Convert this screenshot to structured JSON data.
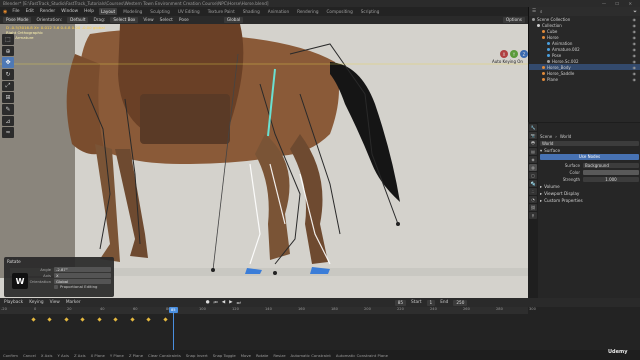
{
  "window": {
    "title": "Blender* [E:\\FastTrack_Studio\\FastTrack_Tutorials\\Courses\\Western Town Environment Creation Course\\NPC\\Horse\\Horse.blend]",
    "controls": "— ☐ ✕"
  },
  "menubar": {
    "menus": [
      "File",
      "Edit",
      "Render",
      "Window",
      "Help"
    ],
    "workspaces": [
      "Layout",
      "Modeling",
      "Sculpting",
      "UV Editing",
      "Texture Paint",
      "Shading",
      "Animation",
      "Rendering",
      "Compositing",
      "Scripting"
    ],
    "active_workspace": "Layout",
    "scene": "Scene",
    "view_layer": "View Layer"
  },
  "viewport_header": {
    "mode": "Pose Mode",
    "items": [
      "Orientation:",
      "Default",
      "Drag:",
      "Select Box",
      "View",
      "Select",
      "Pose"
    ],
    "transform": "Global",
    "options": "Options"
  },
  "viewport": {
    "info_line1": "D -0.5/3016.8  Xr: 0.012 3.6 0.4.8 0.00 -0.00 global",
    "info_line2": "Right Orthographic",
    "info_line3": "(54) Armature",
    "auto_keying": "Auto Keying On",
    "gizmo": [
      "X",
      "Y",
      "Z"
    ],
    "bone_color": "#3b7dd8",
    "horse_color": "#8a5a38",
    "tail_color": "#151515"
  },
  "tools": [
    "select-box",
    "cursor",
    "move",
    "rotate",
    "scale",
    "transform",
    "annotate",
    "measure",
    "relax",
    "push"
  ],
  "rotate_panel": {
    "title": "Rotate",
    "fields": [
      {
        "label": "Angle",
        "value": "-2.87°"
      },
      {
        "label": "Axis",
        "value": "X"
      },
      {
        "label": "Orientation",
        "value": "Global"
      }
    ],
    "checkbox": "Proportional Editing"
  },
  "key_badge": "W",
  "outliner": {
    "search": "",
    "items": [
      {
        "label": "Scene Collection",
        "indent": 0,
        "color": "#9a9a9a"
      },
      {
        "label": "Collection",
        "indent": 1,
        "color": "#cfcfcf"
      },
      {
        "label": "Cube",
        "indent": 2,
        "color": "#e08a3a"
      },
      {
        "label": "Horse",
        "indent": 2,
        "color": "#e08a3a"
      },
      {
        "label": "Animation",
        "indent": 3,
        "color": "#4aa0e0"
      },
      {
        "label": "Armature.002",
        "indent": 3,
        "color": "#4aa0e0"
      },
      {
        "label": "Pose",
        "indent": 3,
        "color": "#4aa0e0"
      },
      {
        "label": "Horse.Sc.002",
        "indent": 3,
        "color": "#a0a0a0"
      },
      {
        "label": "Horse_Body",
        "indent": 2,
        "color": "#e08a3a"
      },
      {
        "label": "Horse_Saddle",
        "indent": 2,
        "color": "#e08a3a"
      },
      {
        "label": "Plane",
        "indent": 2,
        "color": "#e08a3a"
      }
    ]
  },
  "properties": {
    "header_scene": "Scene",
    "header_world": "World",
    "world_name": "World",
    "section_surface": "Surface",
    "use_nodes": "Use Nodes",
    "surface_label": "Surface",
    "surface_value": "Background",
    "color_label": "Color",
    "strength_label": "Strength",
    "strength_value": "1.000",
    "sections": [
      "Volume",
      "Viewport Display",
      "Custom Properties"
    ]
  },
  "timeline": {
    "menus": [
      "Playback",
      "Keying",
      "View",
      "Marker"
    ],
    "current_frame": "85",
    "start_label": "Start",
    "start": "1",
    "end_label": "End",
    "end": "250",
    "ticks": [
      "-20",
      "0",
      "20",
      "40",
      "60",
      "80",
      "100",
      "120",
      "140",
      "160",
      "180",
      "200",
      "220",
      "240",
      "260",
      "280",
      "300"
    ],
    "keyframes": [
      0,
      10,
      20,
      30,
      40,
      50,
      60,
      70,
      80
    ]
  },
  "statusbar": {
    "items": [
      "Confirm",
      "Cancel",
      "X Axis",
      "Y Axis",
      "Z Axis",
      "X Plane",
      "Y Plane",
      "Z Plane",
      "Clear Constraints",
      "Snap Invert",
      "Snap Toggle",
      "Move",
      "Rotate",
      "Resize",
      "Automatic Constraint",
      "Automatic Constraint Plane"
    ]
  },
  "watermark": "Udemy"
}
